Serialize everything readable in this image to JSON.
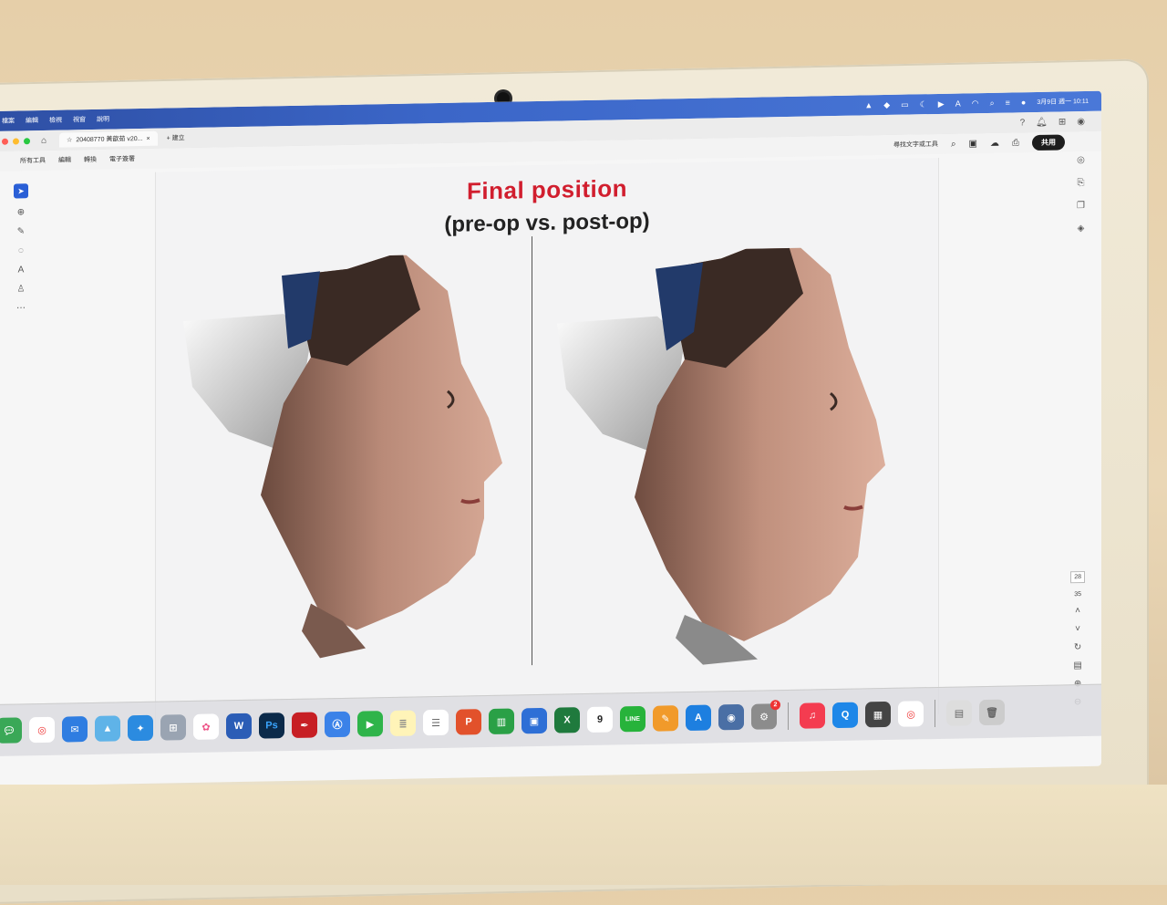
{
  "menubar": {
    "menus": [
      "檔案",
      "編輯",
      "檢視",
      "視窗",
      "說明"
    ],
    "datetime": "3月9日 週一 10:11"
  },
  "browser": {
    "tab_title": "20408770 黃歆茹 v20...",
    "new_tab_label": "建立"
  },
  "toolbar": {
    "menu": [
      "所有工具",
      "編輯",
      "轉換",
      "電子簽署"
    ],
    "search_label": "尋找文字或工具",
    "share_label": "共用"
  },
  "slide": {
    "title": "Final position",
    "subtitle": "(pre-op vs. post-op)"
  },
  "pagination": {
    "current_page": "28",
    "total_pages": "35"
  },
  "dock": {
    "calendar_day": "9",
    "settings_badge": "2",
    "line_label": "LINE",
    "ps_label": "Ps",
    "word_label": "W"
  },
  "colors": {
    "title_red": "#d11e2e",
    "menubar_blue": "#3b66c8",
    "selected_tool": "#2a5fd6"
  }
}
